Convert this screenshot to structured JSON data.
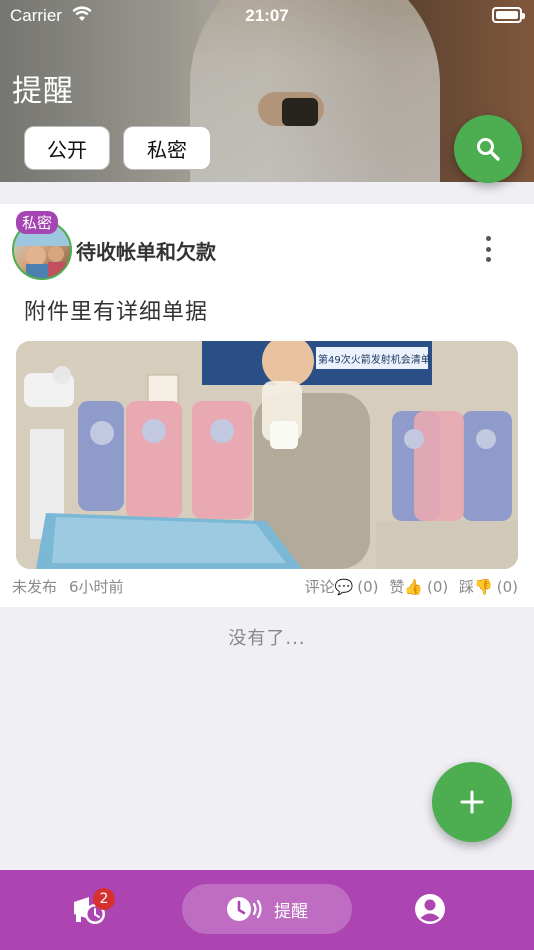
{
  "status_bar": {
    "carrier": "Carrier",
    "time": "21:07"
  },
  "header": {
    "title": "提醒",
    "filters": [
      {
        "label": "公开"
      },
      {
        "label": "私密"
      }
    ]
  },
  "post": {
    "visibility_tag": "私密",
    "title": "待收帐单和欠款",
    "body": "附件里有详细单据",
    "status": "未发布",
    "time_ago": "6小时前",
    "comments_label": "评论",
    "comments_count": "(0)",
    "likes_label": "赞",
    "likes_count": "(0)",
    "dislikes_label": "踩",
    "dislikes_count": "(0)",
    "photo_text": "第49次火箭发射机会清单"
  },
  "list_end": "没有了...",
  "bottom_nav": {
    "reminders_badge": "2",
    "center_label": "提醒"
  },
  "colors": {
    "accent_green": "#4cae50",
    "nav_purple": "#ac44b2",
    "badge_red": "#d6302f"
  }
}
